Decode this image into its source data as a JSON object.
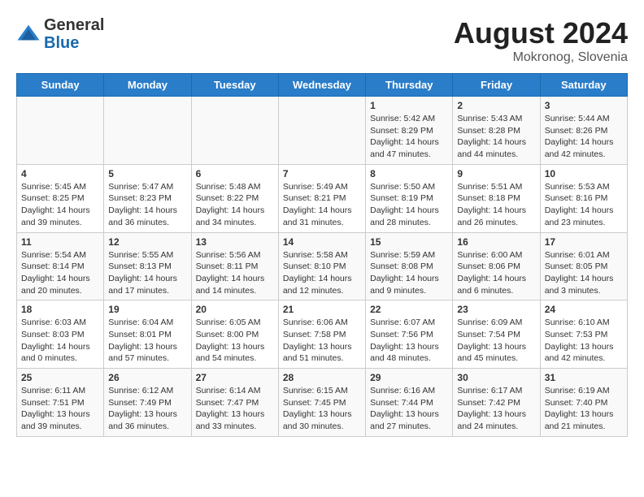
{
  "logo": {
    "general": "General",
    "blue": "Blue"
  },
  "title": "August 2024",
  "location": "Mokronog, Slovenia",
  "days_of_week": [
    "Sunday",
    "Monday",
    "Tuesday",
    "Wednesday",
    "Thursday",
    "Friday",
    "Saturday"
  ],
  "weeks": [
    [
      {
        "day": "",
        "info": ""
      },
      {
        "day": "",
        "info": ""
      },
      {
        "day": "",
        "info": ""
      },
      {
        "day": "",
        "info": ""
      },
      {
        "day": "1",
        "info": "Sunrise: 5:42 AM\nSunset: 8:29 PM\nDaylight: 14 hours and 47 minutes."
      },
      {
        "day": "2",
        "info": "Sunrise: 5:43 AM\nSunset: 8:28 PM\nDaylight: 14 hours and 44 minutes."
      },
      {
        "day": "3",
        "info": "Sunrise: 5:44 AM\nSunset: 8:26 PM\nDaylight: 14 hours and 42 minutes."
      }
    ],
    [
      {
        "day": "4",
        "info": "Sunrise: 5:45 AM\nSunset: 8:25 PM\nDaylight: 14 hours and 39 minutes."
      },
      {
        "day": "5",
        "info": "Sunrise: 5:47 AM\nSunset: 8:23 PM\nDaylight: 14 hours and 36 minutes."
      },
      {
        "day": "6",
        "info": "Sunrise: 5:48 AM\nSunset: 8:22 PM\nDaylight: 14 hours and 34 minutes."
      },
      {
        "day": "7",
        "info": "Sunrise: 5:49 AM\nSunset: 8:21 PM\nDaylight: 14 hours and 31 minutes."
      },
      {
        "day": "8",
        "info": "Sunrise: 5:50 AM\nSunset: 8:19 PM\nDaylight: 14 hours and 28 minutes."
      },
      {
        "day": "9",
        "info": "Sunrise: 5:51 AM\nSunset: 8:18 PM\nDaylight: 14 hours and 26 minutes."
      },
      {
        "day": "10",
        "info": "Sunrise: 5:53 AM\nSunset: 8:16 PM\nDaylight: 14 hours and 23 minutes."
      }
    ],
    [
      {
        "day": "11",
        "info": "Sunrise: 5:54 AM\nSunset: 8:14 PM\nDaylight: 14 hours and 20 minutes."
      },
      {
        "day": "12",
        "info": "Sunrise: 5:55 AM\nSunset: 8:13 PM\nDaylight: 14 hours and 17 minutes."
      },
      {
        "day": "13",
        "info": "Sunrise: 5:56 AM\nSunset: 8:11 PM\nDaylight: 14 hours and 14 minutes."
      },
      {
        "day": "14",
        "info": "Sunrise: 5:58 AM\nSunset: 8:10 PM\nDaylight: 14 hours and 12 minutes."
      },
      {
        "day": "15",
        "info": "Sunrise: 5:59 AM\nSunset: 8:08 PM\nDaylight: 14 hours and 9 minutes."
      },
      {
        "day": "16",
        "info": "Sunrise: 6:00 AM\nSunset: 8:06 PM\nDaylight: 14 hours and 6 minutes."
      },
      {
        "day": "17",
        "info": "Sunrise: 6:01 AM\nSunset: 8:05 PM\nDaylight: 14 hours and 3 minutes."
      }
    ],
    [
      {
        "day": "18",
        "info": "Sunrise: 6:03 AM\nSunset: 8:03 PM\nDaylight: 14 hours and 0 minutes."
      },
      {
        "day": "19",
        "info": "Sunrise: 6:04 AM\nSunset: 8:01 PM\nDaylight: 13 hours and 57 minutes."
      },
      {
        "day": "20",
        "info": "Sunrise: 6:05 AM\nSunset: 8:00 PM\nDaylight: 13 hours and 54 minutes."
      },
      {
        "day": "21",
        "info": "Sunrise: 6:06 AM\nSunset: 7:58 PM\nDaylight: 13 hours and 51 minutes."
      },
      {
        "day": "22",
        "info": "Sunrise: 6:07 AM\nSunset: 7:56 PM\nDaylight: 13 hours and 48 minutes."
      },
      {
        "day": "23",
        "info": "Sunrise: 6:09 AM\nSunset: 7:54 PM\nDaylight: 13 hours and 45 minutes."
      },
      {
        "day": "24",
        "info": "Sunrise: 6:10 AM\nSunset: 7:53 PM\nDaylight: 13 hours and 42 minutes."
      }
    ],
    [
      {
        "day": "25",
        "info": "Sunrise: 6:11 AM\nSunset: 7:51 PM\nDaylight: 13 hours and 39 minutes."
      },
      {
        "day": "26",
        "info": "Sunrise: 6:12 AM\nSunset: 7:49 PM\nDaylight: 13 hours and 36 minutes."
      },
      {
        "day": "27",
        "info": "Sunrise: 6:14 AM\nSunset: 7:47 PM\nDaylight: 13 hours and 33 minutes."
      },
      {
        "day": "28",
        "info": "Sunrise: 6:15 AM\nSunset: 7:45 PM\nDaylight: 13 hours and 30 minutes."
      },
      {
        "day": "29",
        "info": "Sunrise: 6:16 AM\nSunset: 7:44 PM\nDaylight: 13 hours and 27 minutes."
      },
      {
        "day": "30",
        "info": "Sunrise: 6:17 AM\nSunset: 7:42 PM\nDaylight: 13 hours and 24 minutes."
      },
      {
        "day": "31",
        "info": "Sunrise: 6:19 AM\nSunset: 7:40 PM\nDaylight: 13 hours and 21 minutes."
      }
    ]
  ]
}
